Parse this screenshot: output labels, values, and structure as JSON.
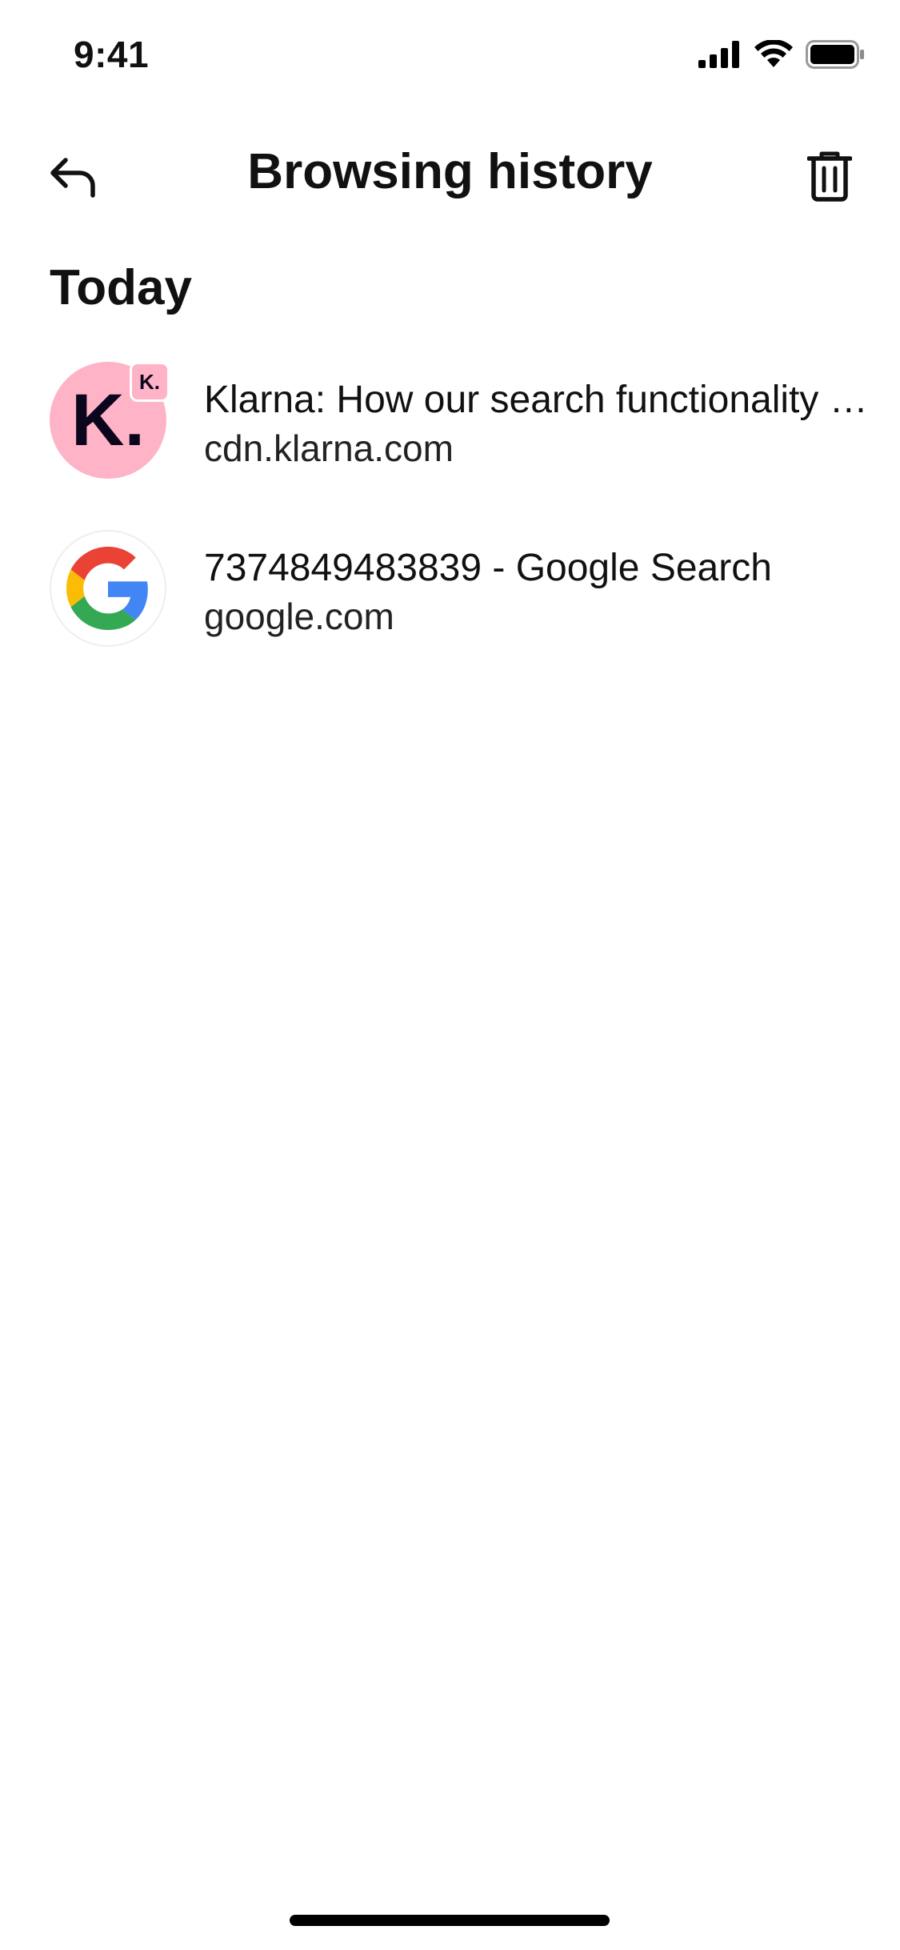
{
  "status_bar": {
    "time": "9:41",
    "icons": [
      "cellular-signal-icon",
      "wifi-icon",
      "battery-icon"
    ]
  },
  "header": {
    "title": "Browsing history",
    "back_icon": "back-arrow-icon",
    "delete_icon": "trash-icon"
  },
  "section": {
    "heading": "Today"
  },
  "history": {
    "items": [
      {
        "title": "Klarna: How our search functionality works",
        "url": "cdn.klarna.com",
        "favicon": "klarna-logo-icon",
        "favicon_letter": "K.",
        "favicon_bg": "#ffb3c7"
      },
      {
        "title": "7374849483839 - Google Search",
        "url": "google.com",
        "favicon": "google-logo-icon"
      }
    ]
  },
  "colors": {
    "background": "#ffffff",
    "text": "#111111",
    "klarna_pink": "#ffb3c7",
    "google_blue": "#4285F4",
    "google_red": "#EA4335",
    "google_yellow": "#FBBC05",
    "google_green": "#34A853"
  }
}
